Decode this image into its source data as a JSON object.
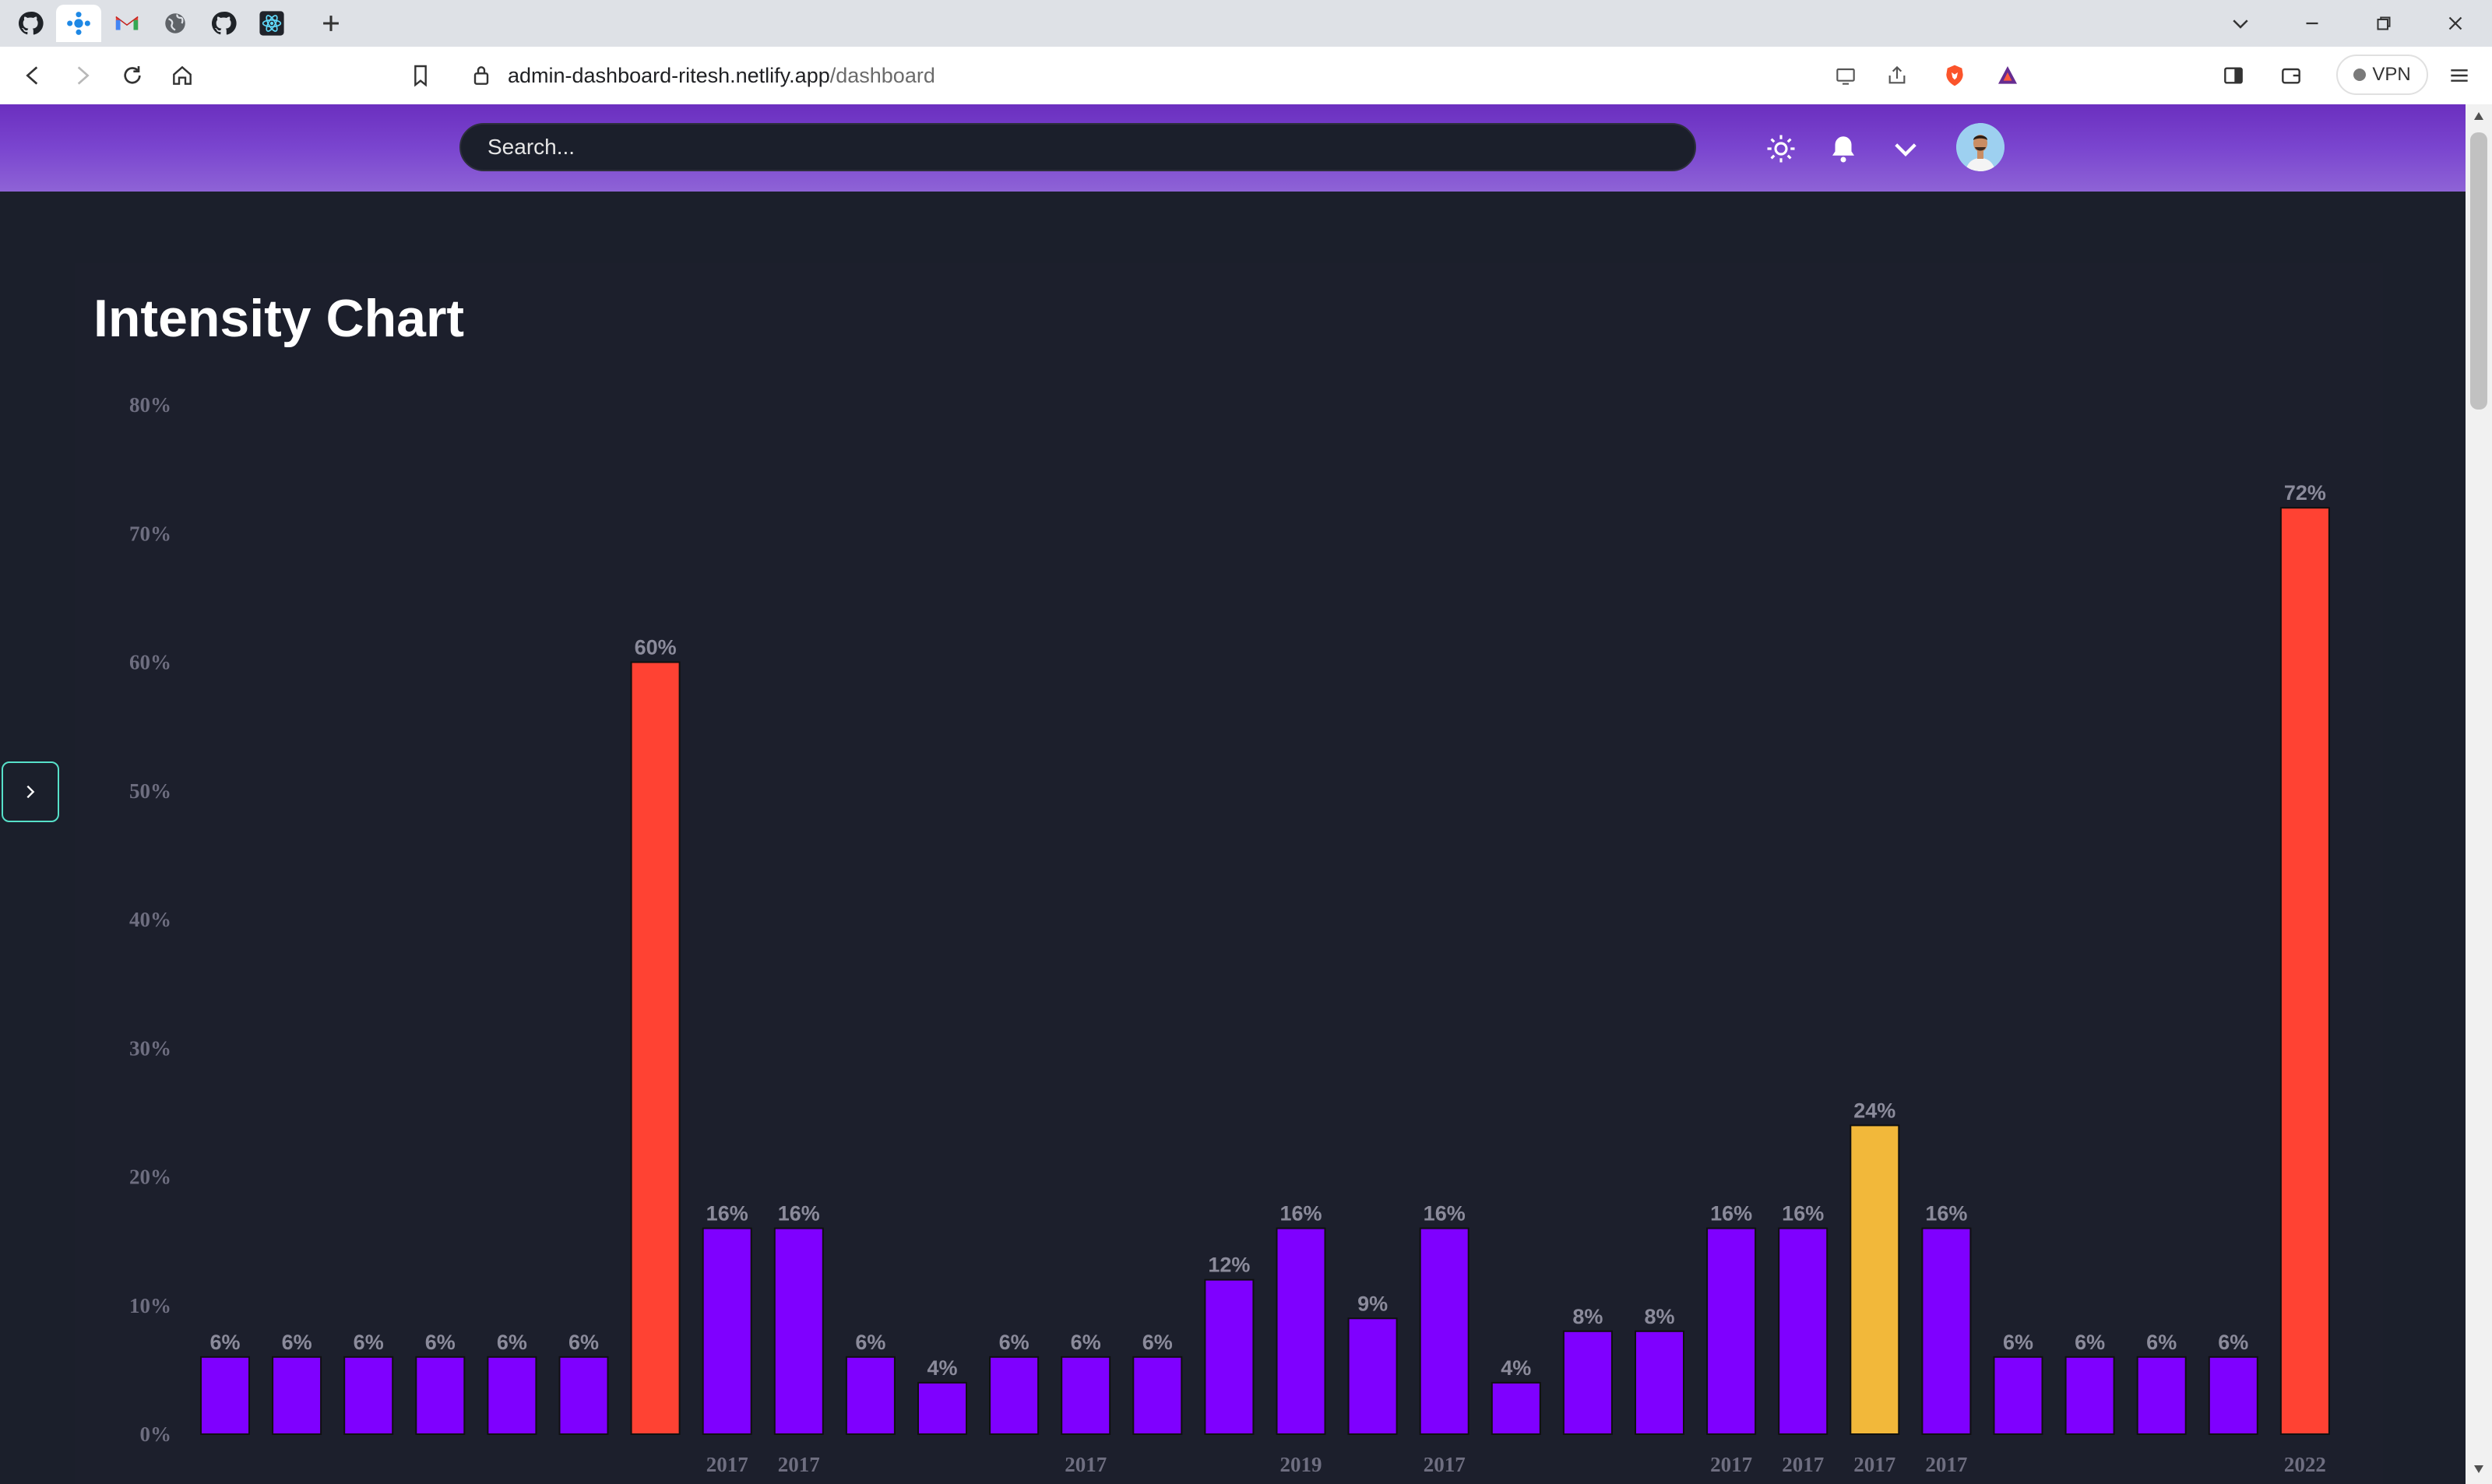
{
  "browser": {
    "tabs": [
      {
        "icon": "github-icon"
      },
      {
        "icon": "dashboard-app-icon",
        "active": true
      },
      {
        "icon": "gmail-icon"
      },
      {
        "icon": "globe-icon"
      },
      {
        "icon": "github-icon"
      },
      {
        "icon": "react-icon"
      }
    ],
    "url_host": "admin-dashboard-ritesh.netlify.app",
    "url_path": "/dashboard",
    "vpn_label": "VPN"
  },
  "header": {
    "search_placeholder": "Search..."
  },
  "colors": {
    "bar_default": "#7f00ff",
    "bar_high": "#ff4233",
    "bar_mid": "#f2b83a",
    "header_gradient_start": "#6b2fbf",
    "header_gradient_end": "#8e63d6",
    "background": "#1b1f2b"
  },
  "chart_title": "Intensity Chart",
  "chart_data": {
    "type": "bar",
    "title": "Intensity Chart",
    "xlabel": "",
    "ylabel": "",
    "ylim": [
      0,
      80
    ],
    "y_ticks": [
      "0%",
      "10%",
      "20%",
      "30%",
      "40%",
      "50%",
      "60%",
      "70%",
      "80%"
    ],
    "grid": false,
    "categories": [
      "",
      "",
      "",
      "",
      "",
      "",
      "",
      "2017",
      "2017",
      "",
      "",
      "",
      "2017",
      "",
      "",
      "2019",
      "",
      "2017",
      "",
      "",
      "",
      "2017",
      "2017",
      "2017",
      "2017",
      "",
      "",
      "",
      "",
      "2022"
    ],
    "values": [
      6,
      6,
      6,
      6,
      6,
      6,
      60,
      16,
      16,
      6,
      4,
      6,
      6,
      6,
      12,
      16,
      9,
      16,
      4,
      8,
      8,
      16,
      16,
      24,
      16,
      6,
      6,
      6,
      6,
      72
    ],
    "value_labels": [
      "6%",
      "6%",
      "6%",
      "6%",
      "6%",
      "6%",
      "60%",
      "16%",
      "16%",
      "6%",
      "4%",
      "6%",
      "6%",
      "6%",
      "12%",
      "16%",
      "9%",
      "16%",
      "4%",
      "8%",
      "8%",
      "16%",
      "16%",
      "24%",
      "16%",
      "6%",
      "6%",
      "6%",
      "6%",
      "72%"
    ]
  }
}
